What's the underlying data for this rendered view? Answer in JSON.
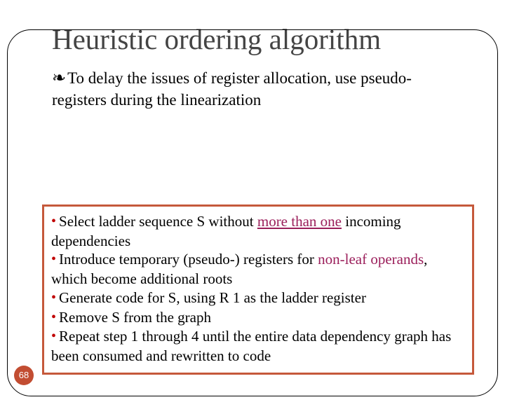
{
  "title": "Heuristic ordering algorithm",
  "lead": {
    "glyph": "❧",
    "text": "To delay the issues of register allocation, use pseudo-registers during the linearization"
  },
  "steps": {
    "s1a": "Select ladder sequence S without ",
    "s1b": "more than one",
    "s1c": "  incoming dependencies",
    "s2a": "Introduce temporary (pseudo-) registers for ",
    "s2b": "non-leaf operands",
    "s2c": ", which become additional roots",
    "s3": "Generate code for S, using R 1 as the ladder register",
    "s4": "Remove S from the graph",
    "s5": "Repeat step 1 through 4 until the entire data dependency graph has been consumed and rewritten to code"
  },
  "slide_number": "68"
}
